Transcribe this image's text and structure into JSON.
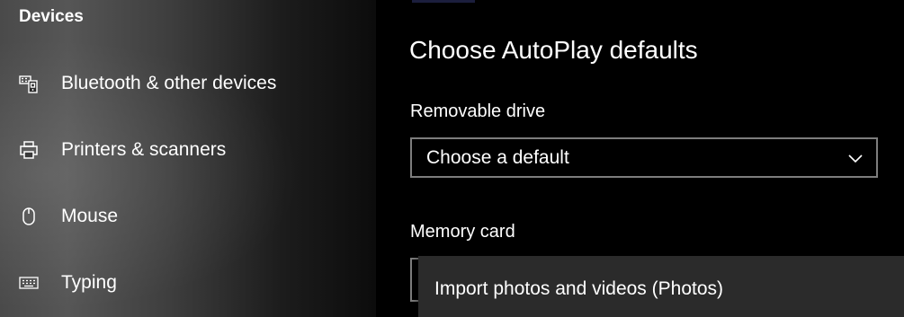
{
  "sidebar": {
    "section_title": "Devices",
    "items": [
      {
        "label": "Bluetooth & other devices",
        "icon": "bluetooth-devices-icon"
      },
      {
        "label": "Printers & scanners",
        "icon": "printer-icon"
      },
      {
        "label": "Mouse",
        "icon": "mouse-icon"
      },
      {
        "label": "Typing",
        "icon": "keyboard-icon"
      }
    ]
  },
  "main": {
    "title": "Choose AutoPlay defaults",
    "removable_drive": {
      "label": "Removable drive",
      "value": "Choose a default"
    },
    "memory_card": {
      "label": "Memory card",
      "open_option": "Import photos and videos (Photos)"
    }
  },
  "colors": {
    "background": "#000000",
    "flyout": "#2b2b2b",
    "border": "#7d7d7d"
  }
}
